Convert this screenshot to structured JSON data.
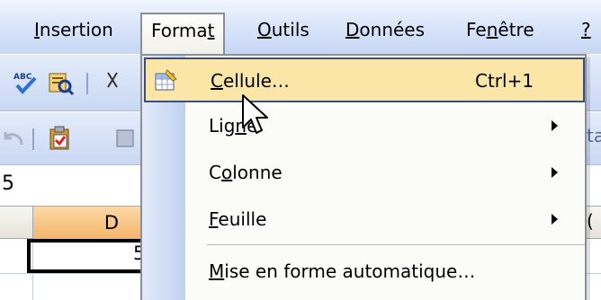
{
  "menubar": {
    "items": [
      {
        "label_pre": "",
        "mnemonic": "I",
        "label_post": "nsertion"
      },
      {
        "label_pre": "Forma",
        "mnemonic": "t",
        "label_post": ""
      },
      {
        "label_pre": "",
        "mnemonic": "O",
        "label_post": "utils"
      },
      {
        "label_pre": "",
        "mnemonic": "D",
        "label_post": "onnées"
      },
      {
        "label_pre": "Fe",
        "mnemonic": "n",
        "label_post": "être"
      },
      {
        "label_pre": "",
        "mnemonic": "?",
        "label_post": ""
      }
    ]
  },
  "namebox": {
    "value": "5"
  },
  "columns": {
    "active": "D"
  },
  "cell": {
    "value": "5"
  },
  "format_menu": {
    "items": [
      {
        "pre": "",
        "mn": "C",
        "post": "ellule…",
        "shortcut": "Ctrl+1"
      },
      {
        "pre": "Lig",
        "mn": "n",
        "post": "e"
      },
      {
        "pre": "C",
        "mn": "o",
        "post": "lonne"
      },
      {
        "pre": "",
        "mn": "F",
        "post": "euille"
      },
      {
        "pre": "",
        "mn": "M",
        "post": "ise en forme automatique…"
      }
    ]
  },
  "colors": {
    "highlight": "#fbe6a8",
    "column_header_active": "#f6b66b",
    "menubar": "#c6d6f4"
  },
  "icons": [
    "spellcheck-icon",
    "research-icon",
    "undo-icon",
    "paste-icon",
    "format-cells-icon",
    "submenu-arrow-icon",
    "mouse-cursor-icon"
  ]
}
